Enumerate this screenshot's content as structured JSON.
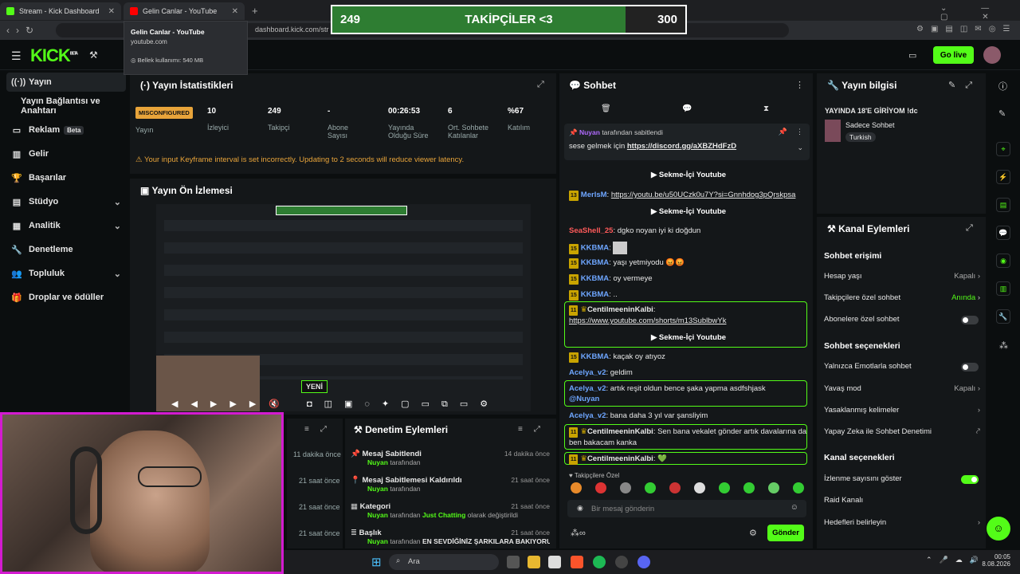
{
  "browser": {
    "tabs": [
      {
        "label": "Stream - Kick Dashboard"
      },
      {
        "label": "Gelin Canlar - YouTube"
      }
    ],
    "url": "dashboard.kick.com/str",
    "tooltip": {
      "title": "Gelin Canlar - YouTube",
      "domain": "youtube.com",
      "memory": "Bellek kullanımı: 540 MB"
    }
  },
  "follow_goal": {
    "current": "249",
    "label": "TAKİPÇİLER <3",
    "target": "300",
    "progress": 0.83
  },
  "header": {
    "logo": "KICK",
    "logo_sup": "BETA",
    "golive": "Go live"
  },
  "sidebar": {
    "items": [
      {
        "label": "Yayın",
        "icon": "antenna-icon"
      },
      {
        "label": "Yayın Bağlantısı ve Anahtarı",
        "icon": ""
      },
      {
        "label": "Reklam",
        "icon": "ad-icon",
        "badge": "Beta"
      },
      {
        "label": "Gelir",
        "icon": "chart-icon"
      },
      {
        "label": "Başarılar",
        "icon": "trophy-icon"
      },
      {
        "label": "Stüdyo",
        "icon": "studio-icon"
      },
      {
        "label": "Analitik",
        "icon": "analytics-icon"
      },
      {
        "label": "Denetleme",
        "icon": "wrench-icon"
      },
      {
        "label": "Topluluk",
        "icon": "community-icon"
      },
      {
        "label": "Droplar ve ödüller",
        "icon": "gift-icon"
      }
    ]
  },
  "stats": {
    "title": "Yayın İstatistikleri",
    "status_badge": "MISCONFIGURED",
    "status_label": "Yayın",
    "items": [
      {
        "value": "10",
        "label": "İzleyici"
      },
      {
        "value": "249",
        "label": "Takipçi"
      },
      {
        "value": "-",
        "label": "Abone Sayısı"
      },
      {
        "value": "00:26:53",
        "label": "Yayında Olduğu Süre"
      },
      {
        "value": "6",
        "label": "Ort. Sohbete Katılanlar"
      },
      {
        "value": "%67",
        "label": "Katılım"
      }
    ],
    "warning": "Your input Keyframe interval is set incorrectly. Updating to 2 seconds will reduce viewer latency."
  },
  "preview": {
    "title": "Yayın Ön İzlemesi",
    "new_badge": "YENİ"
  },
  "activity": {
    "times": [
      "11 dakika önce",
      "21 saat önce",
      "21 saat önce",
      "21 saat önce"
    ]
  },
  "mod": {
    "title": "Denetim Eylemleri",
    "items": [
      {
        "title": "Mesaj Sabitlendi",
        "by": "Nuyan",
        "suffix": "tarafından",
        "time": "14 dakika önce"
      },
      {
        "title": "Mesaj Sabitlemesi Kaldırıldı",
        "by": "Nuyan",
        "suffix": "tarafından",
        "time": "21 saat önce"
      },
      {
        "title": "Kategori",
        "by": "Nuyan",
        "suffix": "tarafından",
        "extra": "Just Chatting",
        "extra_suffix": "olarak değiştirildi",
        "time": "21 saat önce"
      },
      {
        "title": "Başlık",
        "by": "Nuyan",
        "suffix": "tarafından",
        "extra": "EN SEVDİĞİNİZ ŞARKILARA BAKIYORUZ !dc",
        "time": "21 saat önce"
      }
    ]
  },
  "chat": {
    "title": "Sohbet",
    "pinned_by": "Nuyan",
    "pinned_suffix": "tarafından sabitlendi",
    "pinned_text": "sese gelmek için",
    "pinned_link": "https://discord.gg/aXBZHdFzD",
    "youtube_label": "Sekme-İçi Youtube",
    "messages": [
      {
        "lvl": "13",
        "user": "MerlsM",
        "text": "https://youtu.be/u50UCzk0u7Y?si=Gnnhdog3pQrskpsa"
      },
      {
        "user": "SeaShell_25",
        "text": "dgko noyan iyi ki doğdun"
      },
      {
        "lvl": "15",
        "user": "KKBMA",
        "text": ""
      },
      {
        "lvl": "15",
        "user": "KKBMA",
        "text": "yaşı yetmiyodu 😡😡"
      },
      {
        "lvl": "15",
        "user": "KKBMA",
        "text": "oy vermeye"
      },
      {
        "lvl": "15",
        "user": "KKBMA",
        "text": ".."
      },
      {
        "lvl": "11",
        "user": "CentilmeeninKalbi",
        "text": "https://www.youtube.com/shorts/m13SublbwYk"
      },
      {
        "lvl": "15",
        "user": "KKBMA",
        "text": "kaçak oy atıyoz"
      },
      {
        "user": "Acelya_v2",
        "text": "geldim"
      },
      {
        "user": "Acelya_v2",
        "text": "artık reşit oldun bence şaka yapma asdfshjask",
        "mention": "@Nuyan"
      },
      {
        "user": "Acelya_v2",
        "text": "bana daha 3 yıl var şansliyim"
      },
      {
        "lvl": "11",
        "user": "CentilmeeninKalbi",
        "text": "Sen bana vekalet gönder artık davalarına da ben bakacam kanka"
      },
      {
        "lvl": "11",
        "user": "CentilmeeninKalbi",
        "text": "💚"
      }
    ],
    "emote_label": "Takipçilere Özel",
    "input_placeholder": "Bir mesaj gönderin",
    "send": "Gönder"
  },
  "stream_info": {
    "title": "Yayın bilgisi",
    "stream_title": "YAYINDA 18'E GİRİYOM !dc",
    "category": "Sadece Sohbet",
    "tag": "Turkish"
  },
  "channel_actions": {
    "title": "Kanal Eylemleri",
    "chat_access": "Sohbet erişimi",
    "rows1": [
      {
        "label": "Hesap yaşı",
        "value": "Kapalı",
        "type": "chev"
      },
      {
        "label": "Takipçilere özel sohbet",
        "value": "Anında",
        "type": "chev"
      },
      {
        "label": "Abonelere özel sohbet",
        "type": "toggle",
        "on": false
      }
    ],
    "chat_options": "Sohbet seçenekleri",
    "rows2": [
      {
        "label": "Yalnızca Emotlarla sohbet",
        "type": "toggle",
        "on": false
      },
      {
        "label": "Yavaş mod",
        "value": "Kapalı",
        "type": "chev"
      },
      {
        "label": "Yasaklanmış kelimeler",
        "type": "chev"
      },
      {
        "label": "Yapay Zeka ile Sohbet Denetimi",
        "type": "ext"
      }
    ],
    "channel_options": "Kanal seçenekleri",
    "rows3": [
      {
        "label": "İzlenme sayısını göster",
        "type": "toggle",
        "on": true
      },
      {
        "label": "Raid Kanalı",
        "type": "none"
      },
      {
        "label": "Hedefleri belirleyin",
        "type": "chev"
      }
    ]
  },
  "taskbar": {
    "search": "Ara",
    "time": "00:05",
    "date": "8.08.2026"
  },
  "colors": {
    "accent": "#53fc18",
    "warning": "#e8a43a",
    "cam_border": "#d31bd0"
  }
}
